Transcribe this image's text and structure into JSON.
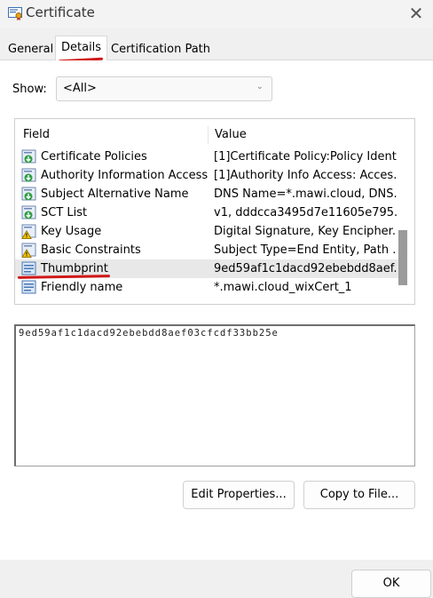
{
  "window": {
    "title": "Certificate",
    "close_glyph": "✕"
  },
  "tabs": [
    {
      "label": "General",
      "active": false
    },
    {
      "label": "Details",
      "active": true
    },
    {
      "label": "Certification Path",
      "active": false
    }
  ],
  "show": {
    "label": "Show:",
    "value": "<All>"
  },
  "list": {
    "columns": [
      "Field",
      "Value"
    ],
    "rows": [
      {
        "field": "Certificate Policies",
        "value": "[1]Certificate Policy:Policy Ident...",
        "icon": "certificate-extension-icon"
      },
      {
        "field": "Authority Information Access",
        "value": "[1]Authority Info Access: Acces...",
        "icon": "certificate-extension-icon"
      },
      {
        "field": "Subject Alternative Name",
        "value": "DNS Name=*.mawi.cloud, DNS...",
        "icon": "certificate-extension-icon"
      },
      {
        "field": "SCT List",
        "value": "v1, dddcca3495d7e11605e795...",
        "icon": "certificate-extension-icon"
      },
      {
        "field": "Key Usage",
        "value": "Digital Signature, Key Encipher...",
        "icon": "critical-extension-warning-icon"
      },
      {
        "field": "Basic Constraints",
        "value": "Subject Type=End Entity, Path ...",
        "icon": "critical-extension-warning-icon"
      },
      {
        "field": "Thumbprint",
        "value": "9ed59af1c1dacd92ebebdd8aef...",
        "icon": "property-icon",
        "selected": true
      },
      {
        "field": "Friendly name",
        "value": "*.mawi.cloud_wixCert_1",
        "icon": "property-icon"
      }
    ]
  },
  "detail": {
    "text": "9ed59af1c1dacd92ebebdd8aef03cfcdf33bb25e"
  },
  "buttons": {
    "edit_properties": "Edit Properties...",
    "copy_to_file": "Copy to File...",
    "ok": "OK"
  },
  "colors": {
    "annotation": "#d01818",
    "selected_row": "#e8e8e8"
  }
}
